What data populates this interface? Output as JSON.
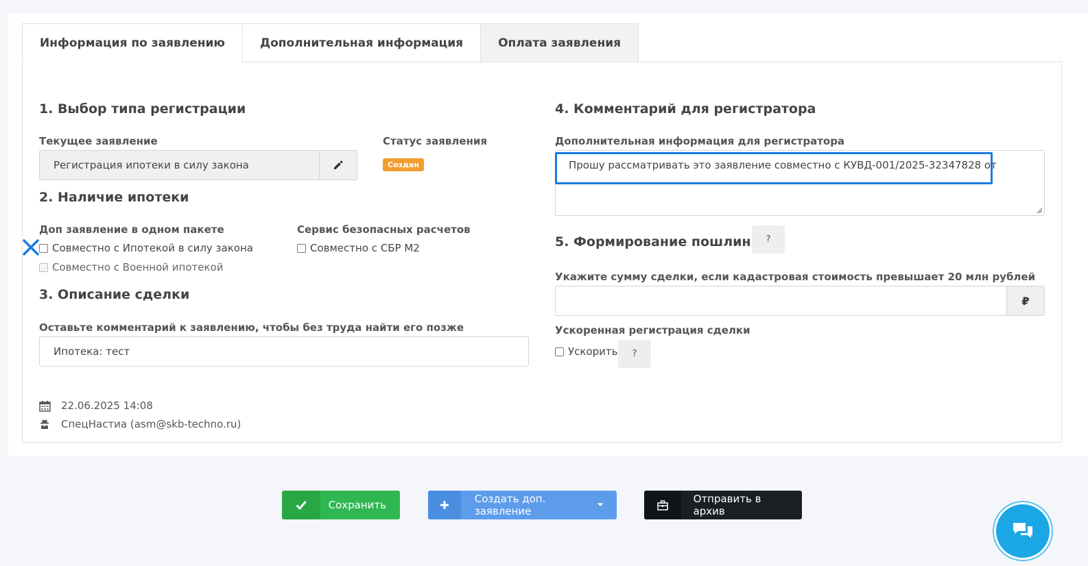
{
  "tabs": [
    {
      "label": "Информация по заявлению"
    },
    {
      "label": "Дополнительная информация"
    },
    {
      "label": "Оплата заявления"
    }
  ],
  "section1": {
    "title": "1. Выбор типа регистрации",
    "current_label": "Текущее заявление",
    "current_value": "Регистрация ипотеки в силу закона",
    "status_label": "Статус заявления",
    "status_badge": "Создан"
  },
  "section2": {
    "title": "2. Наличие ипотеки",
    "package_label": "Доп заявление в одном пакете",
    "cb_mortgage": "Совместно с Ипотекой в силу закона",
    "cb_military": "Совместно с Военной ипотекой",
    "safe_label": "Сервис безопасных расчетов",
    "cb_sbr": "Совместно с СБР М2"
  },
  "section3": {
    "title": "3. Описание сделки",
    "comment_label": "Оставьте комментарий к заявлению, чтобы без труда найти его позже",
    "comment_value": "Ипотека:  тест"
  },
  "meta": {
    "date": "22.06.2025 14:08",
    "user": "СпецНастиа (asm@skb-techno.ru)"
  },
  "section4": {
    "title": "4. Комментарий для регистратора",
    "extra_label": "Дополнительная информация для регистратора",
    "extra_value": "Прошу рассматривать это заявление совместно с КУВД-001/2025-32347828 от"
  },
  "section5": {
    "title": "5. Формирование пошлины",
    "help": "?",
    "sum_label": "Укажите сумму сделки, если кадастровая стоимость превышает 20 млн рублей",
    "currency": "₽",
    "fast_label": "Ускоренная регистрация сделки",
    "cb_fast": "Ускорить",
    "fast_help": "?"
  },
  "buttons": {
    "save": "Сохранить",
    "create": "Создать доп. заявление",
    "archive": "Отправить в архив"
  },
  "colors": {
    "status": "#f39c32",
    "focus": "#1a7be0",
    "save": "#2fb852",
    "create": "#5d9ceb",
    "archive": "#1b1f24",
    "chat": "#1ba7e6"
  }
}
